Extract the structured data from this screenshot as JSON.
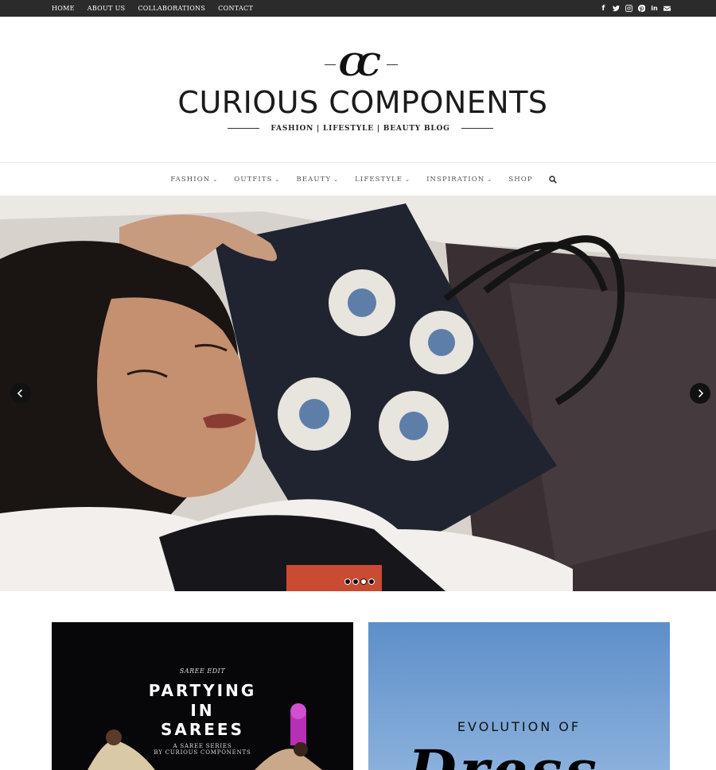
{
  "topbar": {
    "nav": [
      "HOME",
      "ABOUT US",
      "COLLABORATIONS",
      "CONTACT"
    ],
    "social_icons": [
      "facebook-icon",
      "twitter-icon",
      "instagram-icon",
      "pinterest-icon",
      "linkedin-icon",
      "email-icon"
    ]
  },
  "header": {
    "logo_mark": "CC",
    "title": "CURIOUS COMPONENTS",
    "tagline": "FASHION | LIFESTYLE | BEAUTY BLOG"
  },
  "mainnav": {
    "items": [
      {
        "label": "FASHION",
        "dropdown": true
      },
      {
        "label": "OUTFITS",
        "dropdown": true
      },
      {
        "label": "BEAUTY",
        "dropdown": true
      },
      {
        "label": "LIFESTYLE",
        "dropdown": true
      },
      {
        "label": "INSPIRATION",
        "dropdown": true
      },
      {
        "label": "SHOP",
        "dropdown": false
      }
    ],
    "search_icon": "search-icon"
  },
  "slider": {
    "prev_icon": "chevron-left-icon",
    "next_icon": "chevron-right-icon",
    "slide_count": 4,
    "active_slide": 3
  },
  "posts": [
    {
      "kicker": "SAREE EDIT",
      "title_lines": [
        "PARTYING",
        "IN",
        "SAREES"
      ],
      "subtitle_lines": [
        "A SAREE SERIES",
        "BY CURIOUS COMPONENTS"
      ]
    },
    {
      "title": "EVOLUTION OF",
      "script": "Dress"
    }
  ],
  "colors": {
    "topbar_bg": "#2b2b2b",
    "text": "#222222",
    "post_dark": "#0a0a0d",
    "post_sky": "#6f9dd2"
  }
}
